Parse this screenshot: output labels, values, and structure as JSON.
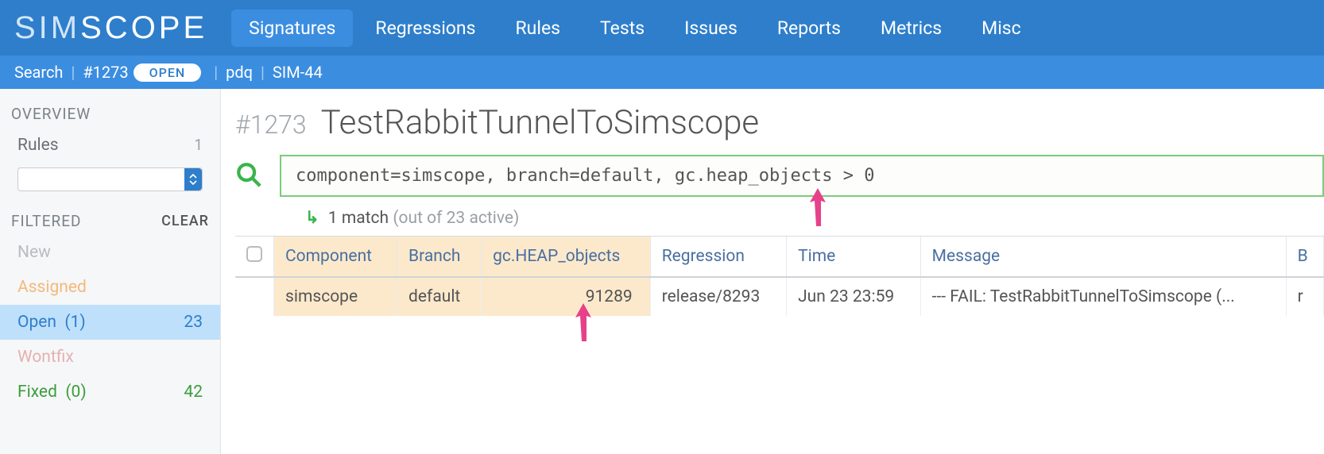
{
  "brand": {
    "part1": "SIM",
    "part2": "SCOPE"
  },
  "nav": {
    "items": [
      "Signatures",
      "Regressions",
      "Rules",
      "Tests",
      "Issues",
      "Reports",
      "Metrics",
      "Misc"
    ],
    "active_index": 0
  },
  "subbar": {
    "search_label": "Search",
    "id": "#1273",
    "status": "OPEN",
    "user": "pdq",
    "ref": "SIM-44"
  },
  "sidebar": {
    "overview_label": "OVERVIEW",
    "rules_label": "Rules",
    "rules_count": "1",
    "filtered_label": "FILTERED",
    "clear_label": "CLEAR",
    "filters": {
      "new": "New",
      "assigned": "Assigned",
      "open_label": "Open",
      "open_paren": "(1)",
      "open_count": "23",
      "wontfix": "Wontfix",
      "fixed_label": "Fixed",
      "fixed_paren": "(0)",
      "fixed_count": "42"
    }
  },
  "main": {
    "id_prefix": "#1273",
    "title": "TestRabbitTunnelToSimscope",
    "query": "component=simscope, branch=default, gc.heap_objects > 0",
    "match_count": "1 match",
    "match_suffix": "(out of 23 active)"
  },
  "table": {
    "headers": {
      "component": "Component",
      "branch": "Branch",
      "heap": "gc.HEAP_objects",
      "regression": "Regression",
      "time": "Time",
      "message": "Message",
      "last": "B"
    },
    "row": {
      "component": "simscope",
      "branch": "default",
      "heap": "91289",
      "regression": "release/8293",
      "time": "Jun 23 23:59",
      "message": "--- FAIL: TestRabbitTunnelToSimscope (...",
      "last": "r"
    }
  }
}
